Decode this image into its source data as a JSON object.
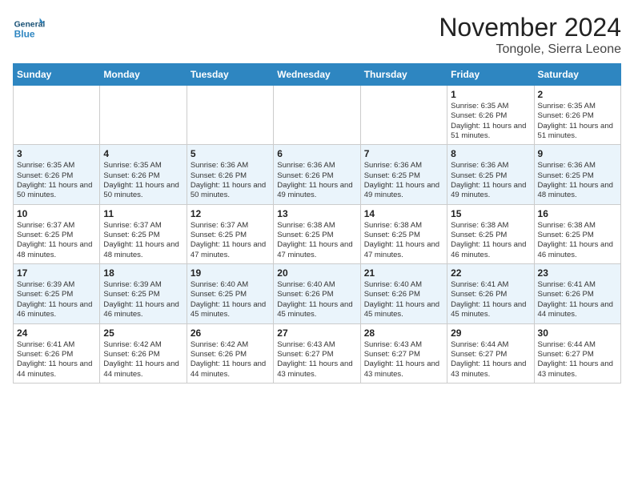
{
  "logo": {
    "general": "General",
    "blue": "Blue"
  },
  "header": {
    "month": "November 2024",
    "location": "Tongole, Sierra Leone"
  },
  "weekdays": [
    "Sunday",
    "Monday",
    "Tuesday",
    "Wednesday",
    "Thursday",
    "Friday",
    "Saturday"
  ],
  "weeks": [
    [
      {
        "day": "",
        "detail": ""
      },
      {
        "day": "",
        "detail": ""
      },
      {
        "day": "",
        "detail": ""
      },
      {
        "day": "",
        "detail": ""
      },
      {
        "day": "",
        "detail": ""
      },
      {
        "day": "1",
        "detail": "Sunrise: 6:35 AM\nSunset: 6:26 PM\nDaylight: 11 hours and 51 minutes."
      },
      {
        "day": "2",
        "detail": "Sunrise: 6:35 AM\nSunset: 6:26 PM\nDaylight: 11 hours and 51 minutes."
      }
    ],
    [
      {
        "day": "3",
        "detail": "Sunrise: 6:35 AM\nSunset: 6:26 PM\nDaylight: 11 hours and 50 minutes."
      },
      {
        "day": "4",
        "detail": "Sunrise: 6:35 AM\nSunset: 6:26 PM\nDaylight: 11 hours and 50 minutes."
      },
      {
        "day": "5",
        "detail": "Sunrise: 6:36 AM\nSunset: 6:26 PM\nDaylight: 11 hours and 50 minutes."
      },
      {
        "day": "6",
        "detail": "Sunrise: 6:36 AM\nSunset: 6:26 PM\nDaylight: 11 hours and 49 minutes."
      },
      {
        "day": "7",
        "detail": "Sunrise: 6:36 AM\nSunset: 6:25 PM\nDaylight: 11 hours and 49 minutes."
      },
      {
        "day": "8",
        "detail": "Sunrise: 6:36 AM\nSunset: 6:25 PM\nDaylight: 11 hours and 49 minutes."
      },
      {
        "day": "9",
        "detail": "Sunrise: 6:36 AM\nSunset: 6:25 PM\nDaylight: 11 hours and 48 minutes."
      }
    ],
    [
      {
        "day": "10",
        "detail": "Sunrise: 6:37 AM\nSunset: 6:25 PM\nDaylight: 11 hours and 48 minutes."
      },
      {
        "day": "11",
        "detail": "Sunrise: 6:37 AM\nSunset: 6:25 PM\nDaylight: 11 hours and 48 minutes."
      },
      {
        "day": "12",
        "detail": "Sunrise: 6:37 AM\nSunset: 6:25 PM\nDaylight: 11 hours and 47 minutes."
      },
      {
        "day": "13",
        "detail": "Sunrise: 6:38 AM\nSunset: 6:25 PM\nDaylight: 11 hours and 47 minutes."
      },
      {
        "day": "14",
        "detail": "Sunrise: 6:38 AM\nSunset: 6:25 PM\nDaylight: 11 hours and 47 minutes."
      },
      {
        "day": "15",
        "detail": "Sunrise: 6:38 AM\nSunset: 6:25 PM\nDaylight: 11 hours and 46 minutes."
      },
      {
        "day": "16",
        "detail": "Sunrise: 6:38 AM\nSunset: 6:25 PM\nDaylight: 11 hours and 46 minutes."
      }
    ],
    [
      {
        "day": "17",
        "detail": "Sunrise: 6:39 AM\nSunset: 6:25 PM\nDaylight: 11 hours and 46 minutes."
      },
      {
        "day": "18",
        "detail": "Sunrise: 6:39 AM\nSunset: 6:25 PM\nDaylight: 11 hours and 46 minutes."
      },
      {
        "day": "19",
        "detail": "Sunrise: 6:40 AM\nSunset: 6:25 PM\nDaylight: 11 hours and 45 minutes."
      },
      {
        "day": "20",
        "detail": "Sunrise: 6:40 AM\nSunset: 6:26 PM\nDaylight: 11 hours and 45 minutes."
      },
      {
        "day": "21",
        "detail": "Sunrise: 6:40 AM\nSunset: 6:26 PM\nDaylight: 11 hours and 45 minutes."
      },
      {
        "day": "22",
        "detail": "Sunrise: 6:41 AM\nSunset: 6:26 PM\nDaylight: 11 hours and 45 minutes."
      },
      {
        "day": "23",
        "detail": "Sunrise: 6:41 AM\nSunset: 6:26 PM\nDaylight: 11 hours and 44 minutes."
      }
    ],
    [
      {
        "day": "24",
        "detail": "Sunrise: 6:41 AM\nSunset: 6:26 PM\nDaylight: 11 hours and 44 minutes."
      },
      {
        "day": "25",
        "detail": "Sunrise: 6:42 AM\nSunset: 6:26 PM\nDaylight: 11 hours and 44 minutes."
      },
      {
        "day": "26",
        "detail": "Sunrise: 6:42 AM\nSunset: 6:26 PM\nDaylight: 11 hours and 44 minutes."
      },
      {
        "day": "27",
        "detail": "Sunrise: 6:43 AM\nSunset: 6:27 PM\nDaylight: 11 hours and 43 minutes."
      },
      {
        "day": "28",
        "detail": "Sunrise: 6:43 AM\nSunset: 6:27 PM\nDaylight: 11 hours and 43 minutes."
      },
      {
        "day": "29",
        "detail": "Sunrise: 6:44 AM\nSunset: 6:27 PM\nDaylight: 11 hours and 43 minutes."
      },
      {
        "day": "30",
        "detail": "Sunrise: 6:44 AM\nSunset: 6:27 PM\nDaylight: 11 hours and 43 minutes."
      }
    ]
  ]
}
